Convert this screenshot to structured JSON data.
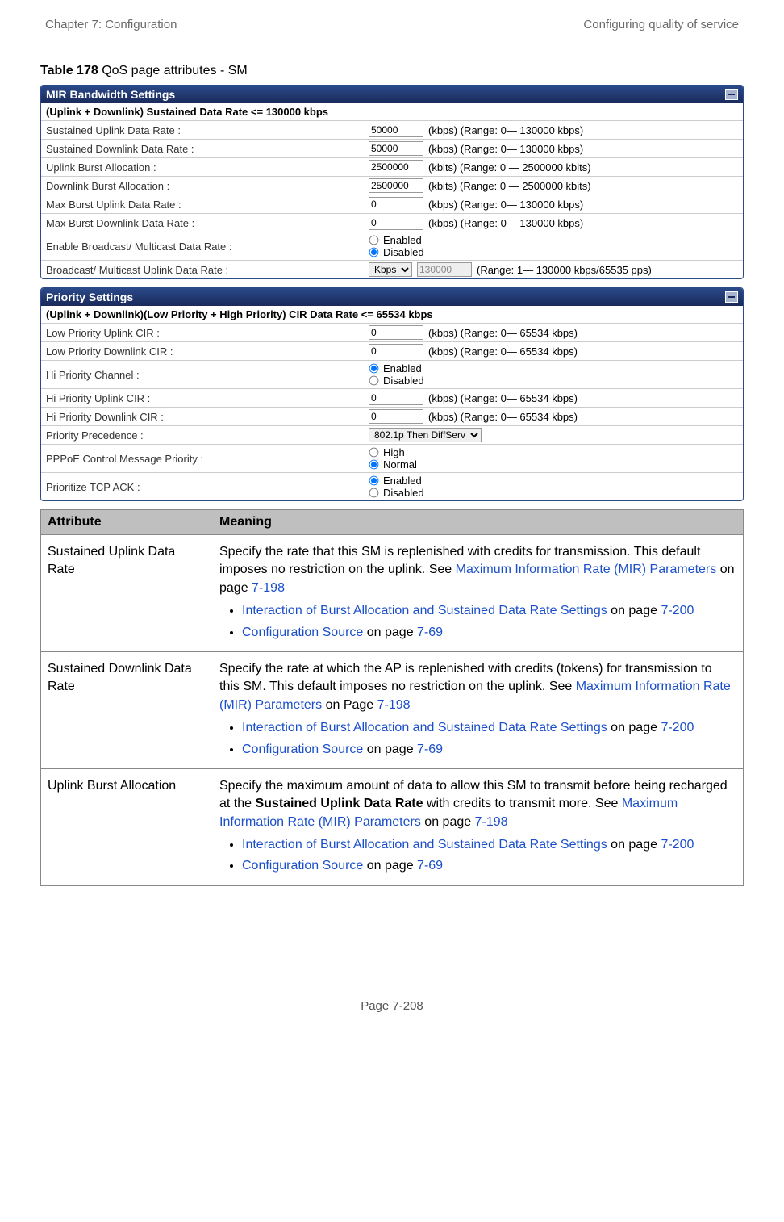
{
  "header": {
    "left": "Chapter 7:  Configuration",
    "right": "Configuring quality of service"
  },
  "caption_bold": "Table 178",
  "caption_rest": " QoS page attributes - SM",
  "panel1": {
    "title": "MIR Bandwidth Settings",
    "subheader": "(Uplink + Downlink) Sustained Data Rate <= 130000 kbps",
    "rows": [
      {
        "label": "Sustained Uplink Data Rate :",
        "value": "50000",
        "after": "(kbps) (Range: 0— 130000 kbps)"
      },
      {
        "label": "Sustained Downlink Data Rate :",
        "value": "50000",
        "after": "(kbps) (Range: 0— 130000 kbps)"
      },
      {
        "label": "Uplink Burst Allocation :",
        "value": "2500000",
        "after": "(kbits) (Range: 0 — 2500000 kbits)"
      },
      {
        "label": "Downlink Burst Allocation :",
        "value": "2500000",
        "after": "(kbits) (Range: 0 — 2500000 kbits)"
      },
      {
        "label": "Max Burst Uplink Data Rate :",
        "value": "0",
        "after": "(kbps) (Range: 0— 130000 kbps)"
      },
      {
        "label": "Max Burst Downlink Data Rate :",
        "value": "0",
        "after": "(kbps) (Range: 0— 130000 kbps)"
      }
    ],
    "row_broadcast": {
      "label": "Enable Broadcast/ Multicast Data Rate :",
      "opt1": "Enabled",
      "opt2": "Disabled"
    },
    "row_bmul": {
      "label": "Broadcast/ Multicast Uplink Data Rate :",
      "select": "Kbps",
      "value": "130000",
      "after": "(Range: 1— 130000 kbps/65535 pps)"
    }
  },
  "panel2": {
    "title": "Priority Settings",
    "subheader": "(Uplink + Downlink)(Low Priority + High Priority) CIR Data Rate <= 65534 kbps",
    "rows_top": [
      {
        "label": "Low Priority Uplink CIR :",
        "value": "0",
        "after": "(kbps) (Range: 0— 65534 kbps)"
      },
      {
        "label": "Low Priority Downlink CIR :",
        "value": "0",
        "after": "(kbps) (Range: 0— 65534 kbps)"
      }
    ],
    "row_hichan": {
      "label": "Hi Priority Channel :",
      "opt1": "Enabled",
      "opt2": "Disabled"
    },
    "rows_mid": [
      {
        "label": "Hi Priority Uplink CIR :",
        "value": "0",
        "after": "(kbps) (Range: 0— 65534 kbps)"
      },
      {
        "label": "Hi Priority Downlink CIR :",
        "value": "0",
        "after": "(kbps) (Range: 0— 65534 kbps)"
      }
    ],
    "row_prec": {
      "label": "Priority Precedence :",
      "select": "802.1p Then DiffServ"
    },
    "row_pppoe": {
      "label": "PPPoE Control Message Priority :",
      "opt1": "High",
      "opt2": "Normal"
    },
    "row_tcp": {
      "label": "Prioritize TCP ACK :",
      "opt1": "Enabled",
      "opt2": "Disabled"
    }
  },
  "desc_header": {
    "col1": "Attribute",
    "col2": "Meaning"
  },
  "desc_rows": [
    {
      "attr": "Sustained Uplink Data Rate",
      "p1a": "Specify the rate that this SM is replenished with credits for transmission. This default imposes no restriction on the uplink. See ",
      "link1": "Maximum Information Rate (MIR) Parameters",
      "p1b": " on page ",
      "link2": "7-198",
      "b1a_link": "Interaction of Burst Allocation and Sustained Data Rate Settings",
      "b1a_txt": " on page ",
      "b1a_pg": "7-200",
      "b1b_link": "Configuration Source",
      "b1b_txt": " on page ",
      "b1b_pg": "7-69"
    },
    {
      "attr": "Sustained Downlink Data Rate",
      "p1a": "Specify the rate at which the AP is replenished with credits (tokens) for transmission to this SM. This default imposes no restriction on the uplink. See ",
      "link1": "Maximum Information Rate (MIR) Parameters",
      "p1b": " on Page ",
      "link2": "7-198",
      "b1a_link": "Interaction of Burst Allocation and Sustained Data Rate Settings",
      "b1a_txt": " on page ",
      "b1a_pg": "7-200",
      "b1b_link": "Configuration Source",
      "b1b_txt": " on page ",
      "b1b_pg": "7-69"
    },
    {
      "attr": "Uplink Burst Allocation",
      "p1a": "Specify the maximum amount of data to allow this SM to transmit before being recharged at the ",
      "boldmid": "Sustained Uplink Data Rate",
      "p1b": " with credits to transmit more. See ",
      "link1": "Maximum Information Rate (MIR) Parameters",
      "p1c": " on page ",
      "link2": "7-198",
      "b1a_link": "Interaction of Burst Allocation and Sustained Data Rate Settings",
      "b1a_txt": " on page ",
      "b1a_pg": "7-200",
      "b1b_link": "Configuration Source",
      "b1b_txt": " on page ",
      "b1b_pg": "7-69"
    }
  ],
  "footer": "Page 7-208"
}
